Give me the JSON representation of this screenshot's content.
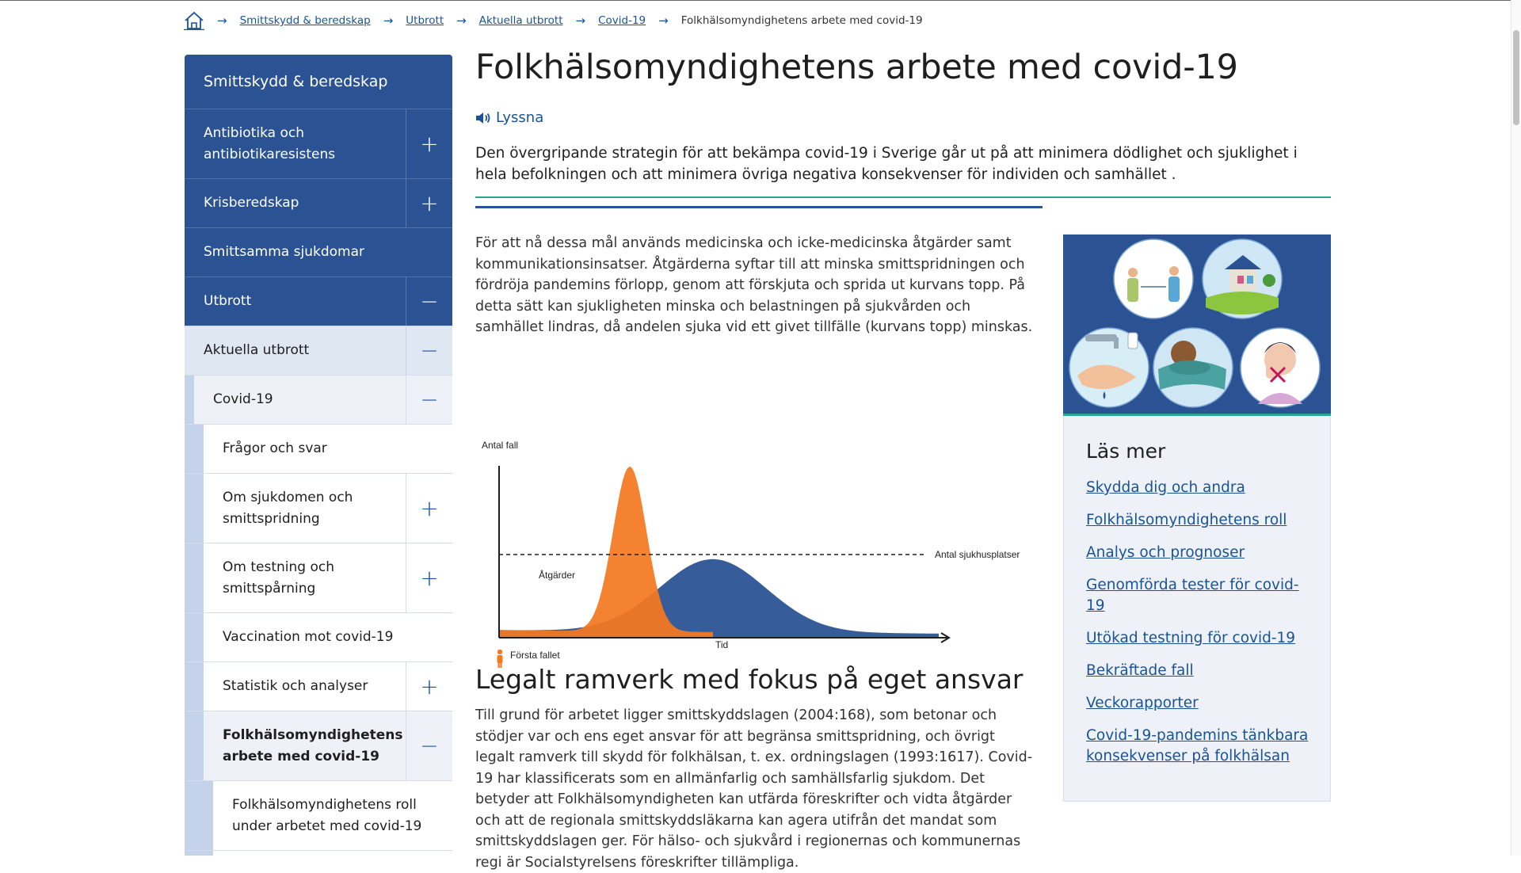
{
  "breadcrumb": {
    "home_icon": "home-icon",
    "items": [
      "Smittskydd & beredskap",
      "Utbrott",
      "Aktuella utbrott",
      "Covid-19"
    ],
    "current": "Folkhälsomyndighetens arbete med covid-19"
  },
  "sidebar": {
    "title": "Smittskydd & beredskap",
    "level1": [
      {
        "label": "Antibiotika och antibiotikaresistens",
        "toggle": "+"
      },
      {
        "label": "Krisberedskap",
        "toggle": "+"
      },
      {
        "label": "Smittsamma sjukdomar",
        "toggle": ""
      },
      {
        "label": "Utbrott",
        "toggle": "−"
      }
    ],
    "level2": {
      "label": "Aktuella utbrott",
      "toggle": "−"
    },
    "level3": {
      "label": "Covid-19",
      "toggle": "−"
    },
    "level4": [
      {
        "label": "Frågor och svar",
        "toggle": ""
      },
      {
        "label": "Om sjukdomen och smittspridning",
        "toggle": "+"
      },
      {
        "label": "Om testning och smittspårning",
        "toggle": "+"
      },
      {
        "label": "Vaccination mot covid-19",
        "toggle": ""
      },
      {
        "label": "Statistik och analyser",
        "toggle": "+"
      },
      {
        "label": "Folkhälsomyndighetens arbete med covid-19",
        "toggle": "−"
      }
    ],
    "level5": [
      {
        "label": "Folkhälsomyndighetens roll under arbetet med covid-19"
      }
    ]
  },
  "main": {
    "title": "Folkhälsomyndighetens arbete med covid-19",
    "listen_label": "Lyssna",
    "lead": "Den övergripande strategin för att bekämpa covid-19 i Sverige går ut på att minimera dödlighet och sjuklighet i hela befolkningen och att minimera övriga negativa konsekvenser för individen och samhället .",
    "paragraph1": "För att nå dessa mål används medicinska och icke-medicinska åtgärder samt kommunikationsinsatser. Åtgärderna syftar till att minska smittspridningen och fördröja pandemins förlopp, genom att förskjuta och sprida ut kurvans topp. På detta sätt kan sjukligheten minska och belastningen på sjukvården och samhället lindras, då andelen sjuka vid ett givet tillfälle (kurvans topp) minskas.",
    "heading2": "Legalt ramverk med fokus på eget ansvar",
    "paragraph2": "Till grund för arbetet ligger smittskyddslagen (2004:168), som betonar och stödjer var och ens eget ansvar för att begränsa smittspridning, och övrigt legalt ramverk till skydd för folkhälsan, t. ex. ordningslagen (1993:1617). Covid-19 har klassificerats som en allmänfarlig och samhällsfarlig sjukdom. Det betyder att Folkhälsomyndigheten kan utfärda föreskrifter och vidta åtgärder och att de regionala smittskyddsläkarna kan agera utifrån det mandat som smittskyddslagen ger. För hälso- och sjukvård i regionernas och kommunernas regi är Socialstyrelsens föreskrifter tillämpliga."
  },
  "chart_data": {
    "type": "area",
    "title": "",
    "ylabel": "Antal fall",
    "xlabel": "Tid",
    "reference_line_label": "Antal sjukhusplatser",
    "annotations": [
      "Åtgärder",
      "Första fallet"
    ],
    "series": [
      {
        "color": "#f47920"
      },
      {
        "color": "#2b5393"
      }
    ]
  },
  "aside": {
    "illustration_icons": [
      "distance-icon",
      "home-icon",
      "handwash-icon",
      "cough-elbow-icon",
      "no-face-touch-icon"
    ],
    "heading": "Läs mer",
    "links": [
      "Skydda dig och andra",
      "Folkhälsomyndighetens roll",
      "Analys och prognoser",
      "Genomförda tester för covid-19",
      "Utökad testning för covid-19",
      "Bekräftade fall",
      "Veckorapporter",
      "Covid-19-pandemins tänkbara konsekvenser på folkhälsan"
    ]
  },
  "colors": {
    "brand_blue": "#2b5393",
    "link": "#1a5296",
    "accent_green": "#2ba48f",
    "orange": "#f47920"
  }
}
